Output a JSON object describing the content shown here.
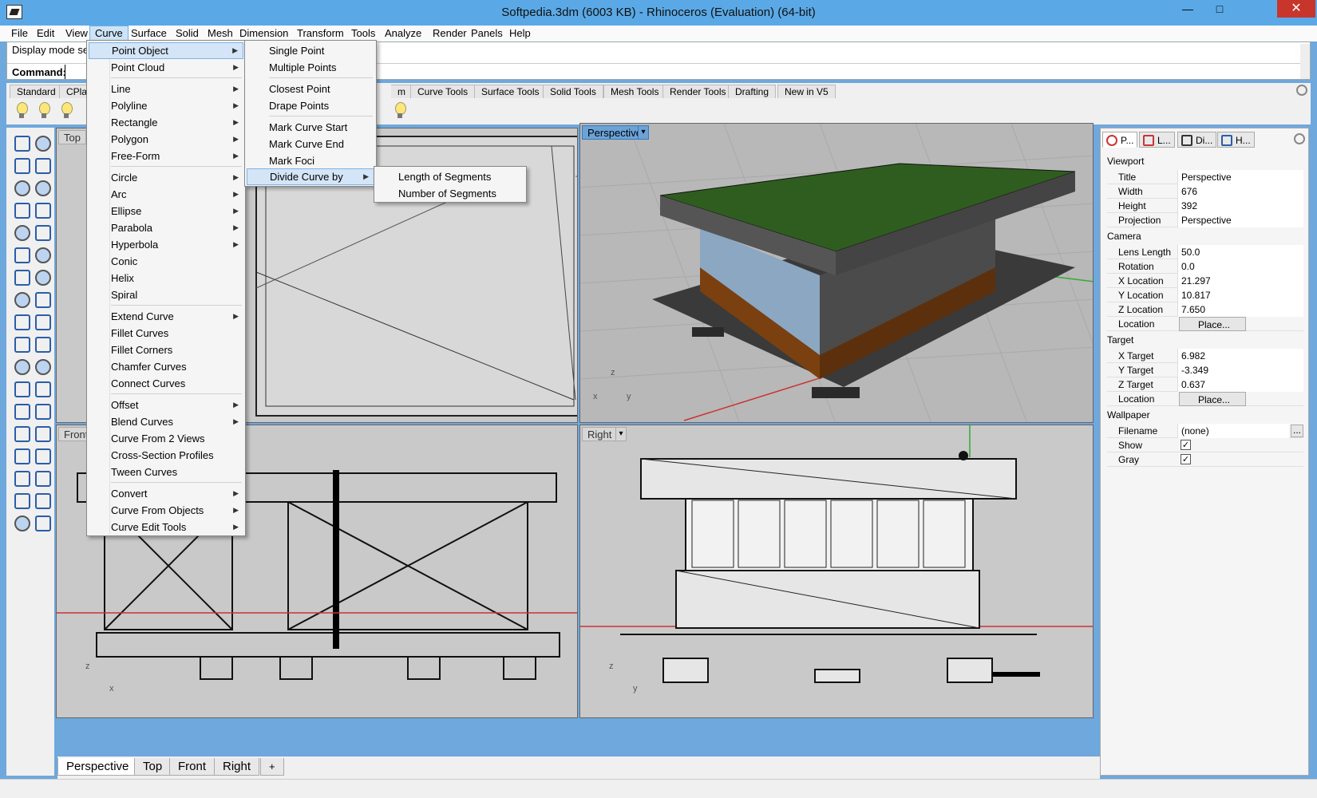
{
  "window": {
    "title": "Softpedia.3dm (6003 KB) - Rhinoceros (Evaluation) (64-bit)",
    "minimize": "—",
    "maximize": "□",
    "close": "✕"
  },
  "menubar": [
    "File",
    "Edit",
    "View",
    "Curve",
    "Surface",
    "Solid",
    "Mesh",
    "Dimension",
    "Transform",
    "Tools",
    "Analyze",
    "Render",
    "Panels",
    "Help"
  ],
  "command": {
    "history": "Display mode set",
    "label": "Command:",
    "value": ""
  },
  "toolbar_tabs": [
    "Standard",
    "CPlan",
    "m",
    "Curve Tools",
    "Surface Tools",
    "Solid Tools",
    "Mesh Tools",
    "Render Tools",
    "Drafting",
    "New in V5"
  ],
  "viewports": {
    "top": "Top",
    "perspective": "Perspective",
    "front": "Front",
    "right": "Right",
    "dropdown": "▾"
  },
  "bottom_tabs": [
    "Perspective",
    "Top",
    "Front",
    "Right",
    "+"
  ],
  "curve_menu": {
    "items": [
      "Point Object",
      "Point Cloud",
      "Line",
      "Polyline",
      "Rectangle",
      "Polygon",
      "Free-Form",
      "Circle",
      "Arc",
      "Ellipse",
      "Parabola",
      "Hyperbola",
      "Conic",
      "Helix",
      "Spiral",
      "Extend Curve",
      "Fillet Curves",
      "Fillet Corners",
      "Chamfer Curves",
      "Connect Curves",
      "Offset",
      "Blend Curves",
      "Curve From 2 Views",
      "Cross-Section Profiles",
      "Tween Curves",
      "Convert",
      "Curve From Objects",
      "Curve Edit Tools"
    ],
    "arrow": "▶"
  },
  "point_menu": {
    "items": [
      "Single Point",
      "Multiple Points",
      "Closest Point",
      "Drape Points",
      "Mark Curve Start",
      "Mark Curve End",
      "Mark Foci",
      "Divide Curve by"
    ]
  },
  "divide_menu": {
    "items": [
      "Length of Segments",
      "Number of Segments"
    ]
  },
  "panel": {
    "tabs": [
      "P...",
      "L...",
      "Di...",
      "H..."
    ],
    "sections": {
      "viewport": "Viewport",
      "camera": "Camera",
      "target": "Target",
      "wallpaper": "Wallpaper"
    },
    "rows": {
      "title": {
        "k": "Title",
        "v": "Perspective"
      },
      "width": {
        "k": "Width",
        "v": "676"
      },
      "height": {
        "k": "Height",
        "v": "392"
      },
      "projection": {
        "k": "Projection",
        "v": "Perspective"
      },
      "lens": {
        "k": "Lens Length",
        "v": "50.0"
      },
      "rotation": {
        "k": "Rotation",
        "v": "0.0"
      },
      "xloc": {
        "k": "X Location",
        "v": "21.297"
      },
      "yloc": {
        "k": "Y Location",
        "v": "10.817"
      },
      "zloc": {
        "k": "Z Location",
        "v": "7.650"
      },
      "cam_location": {
        "k": "Location",
        "v": "Place..."
      },
      "xt": {
        "k": "X Target",
        "v": "6.982"
      },
      "yt": {
        "k": "Y Target",
        "v": "-3.349"
      },
      "zt": {
        "k": "Z Target",
        "v": "0.637"
      },
      "tgt_location": {
        "k": "Location",
        "v": "Place..."
      },
      "filename": {
        "k": "Filename",
        "v": "(none)"
      },
      "show": {
        "k": "Show",
        "v": "✓"
      },
      "gray": {
        "k": "Gray",
        "v": "✓"
      },
      "ellipsis": "..."
    }
  },
  "axis_labels": {
    "x": "x",
    "y": "y",
    "z": "z"
  },
  "colors": {
    "accent": "#5aa9e6",
    "roof": "#2f5d1f",
    "wall": "#8a4a14",
    "viewport_bg": "#c9c9c9"
  }
}
